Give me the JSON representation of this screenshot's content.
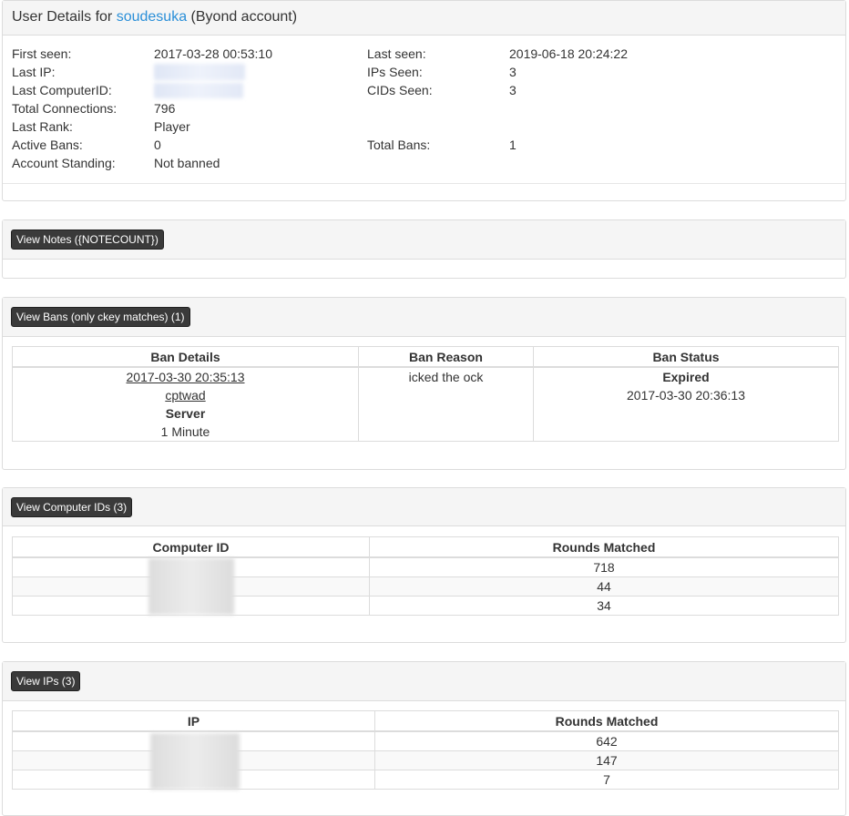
{
  "header": {
    "title_prefix": "User Details for ",
    "username": "soudesuka",
    "title_suffix": " (Byond account)"
  },
  "details": {
    "first_seen_label": "First seen:",
    "first_seen_value": "2017-03-28 00:53:10",
    "last_ip_label": "Last IP:",
    "last_cid_label": "Last ComputerID:",
    "total_connections_label": "Total Connections:",
    "total_connections_value": "796",
    "last_rank_label": "Last Rank:",
    "last_rank_value": "Player",
    "active_bans_label": "Active Bans:",
    "active_bans_value": "0",
    "account_standing_label": "Account Standing:",
    "account_standing_value": "Not banned",
    "last_seen_label": "Last seen:",
    "last_seen_value": "2019-06-18 20:24:22",
    "ips_seen_label": "IPs Seen:",
    "ips_seen_value": "3",
    "cids_seen_label": "CIDs Seen:",
    "cids_seen_value": "3",
    "total_bans_label": "Total Bans:",
    "total_bans_value": "1"
  },
  "notes": {
    "button_label": "View Notes ({NOTECOUNT})"
  },
  "bans": {
    "button_label": "View Bans (only ckey matches) (1)",
    "columns": [
      "Ban Details",
      "Ban Reason",
      "Ban Status"
    ],
    "row": {
      "date": "2017-03-30 20:35:13",
      "admin": "cptwad",
      "server": "Server",
      "duration": "1 Minute",
      "reason": "icked the ock",
      "status": "Expired",
      "expired_at": "2017-03-30 20:36:13"
    }
  },
  "cids": {
    "button_label": "View Computer IDs (3)",
    "columns": [
      "Computer ID",
      "Rounds Matched"
    ],
    "rounds": [
      "718",
      "44",
      "34"
    ]
  },
  "ips": {
    "button_label": "View IPs (3)",
    "columns": [
      "IP",
      "Rounds Matched"
    ],
    "rounds": [
      "642",
      "147",
      "7"
    ]
  }
}
